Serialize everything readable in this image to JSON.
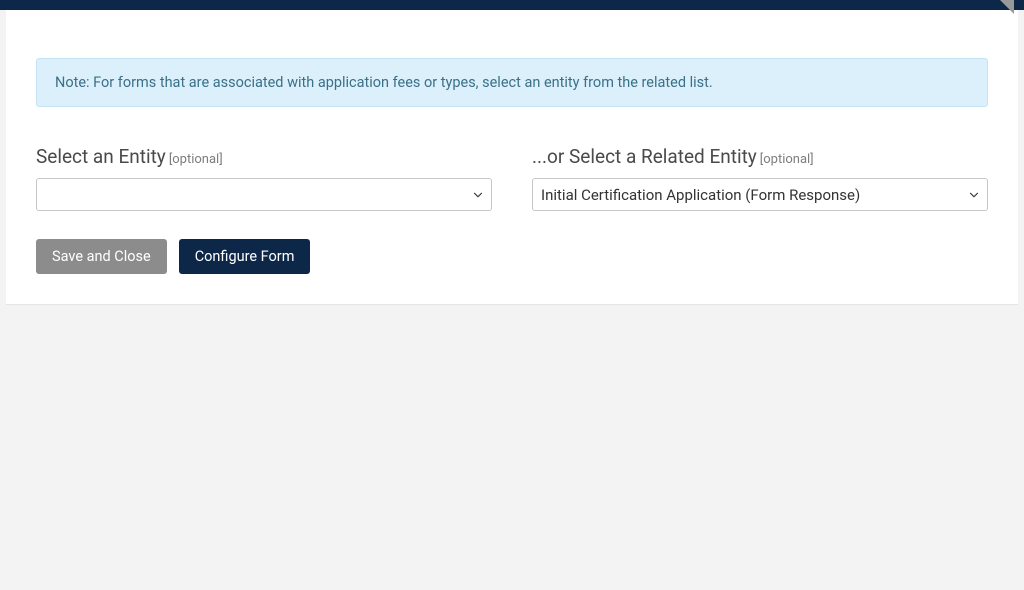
{
  "note": {
    "text": "Note: For forms that are associated with application fees or types, select an entity from the related list."
  },
  "form": {
    "entity": {
      "label": "Select an Entity",
      "optional_tag": "[optional]",
      "selected": ""
    },
    "related_entity": {
      "label": "...or Select a Related Entity",
      "optional_tag": "[optional]",
      "selected": "Initial Certification Application (Form Response)"
    }
  },
  "buttons": {
    "save_close": "Save and Close",
    "configure": "Configure Form"
  }
}
